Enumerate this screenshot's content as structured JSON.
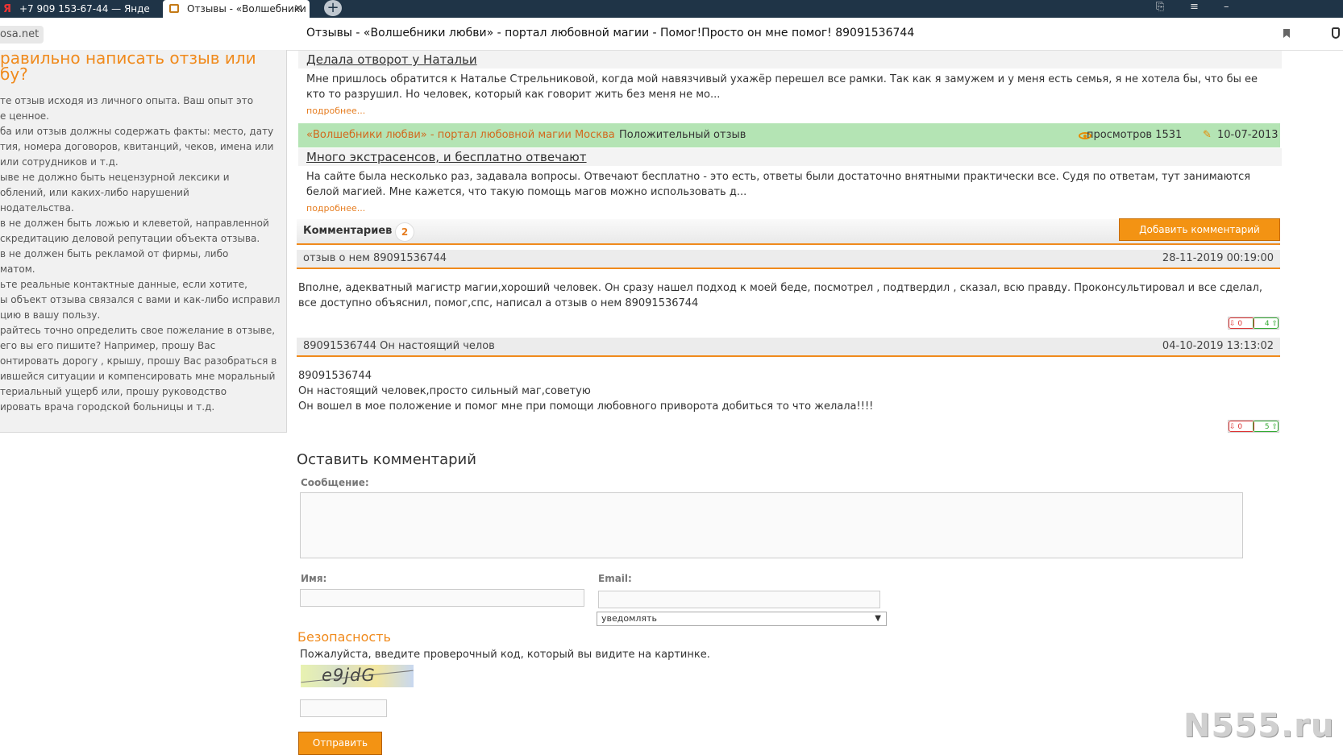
{
  "browser": {
    "tabs": [
      {
        "label": "+7 909 153-67-44 — Янде"
      },
      {
        "label": "Отзывы - «Волшебники"
      }
    ],
    "window_controls": {
      "close_tab": "✕",
      "new_tab": "+",
      "menu": "≡",
      "minimize": "–",
      "bookmarks": "⎘"
    },
    "domain": "osa.net",
    "page_title": "Отзывы - «Волшебники любви» - портал любовной магии - Помог!Просто он мне помог! 89091536744"
  },
  "sidebar": {
    "title_lines": [
      "равильно написать отзыв или",
      "бу?"
    ],
    "lines": [
      "те отзыв исходя из личного опыта. Ваш опыт это",
      "е ценное.",
      "ба или отзыв должны содержать факты: место, дату",
      "тия, номера договоров, квитанций, чеков, имена или",
      "или сотрудников и т.д.",
      "ыве не должно быть нецензурной лексики и",
      "облений, или каких-либо нарушений",
      "нодательства.",
      "в не должен быть ложью и клеветой, направленной",
      "скредитацию деловой репутации объекта отзыва.",
      "в не должен быть рекламой от фирмы, либо",
      "матом.",
      "ьте реальные контактные данные, если хотите,",
      "ы объект отзыва связался с вами и как-либо исправил",
      "цию в вашу пользу.",
      "райтесь точно определить свое пожелание в отзыве,",
      "его вы его пишите? Например, прошу Вас",
      "онтировать дорогу , крышу, прошу Вас разобраться в",
      "ившейся ситуации и компенсировать мне моральный",
      "териальный ущерб или, прошу руководство",
      "ировать врача городской больницы и т.д."
    ]
  },
  "related": [
    {
      "title": "Делала отворот у Натальи",
      "body": "Мне пришлось обратится к Наталье Стрельниковой, когда мой навязчивый ухажёр перешел все рамки. Так как я замужем и у меня есть семья, я не хотела бы, что бы ее кто то разрушил. Но человек, который как говорит жить без меня не мо...",
      "more": "подробнее..."
    },
    {
      "title": "Много экстрасенсов, и бесплатно отвечают",
      "body": "На сайте была несколько раз, задавала вопросы. Отвечают бесплатно - это есть, ответы были достаточно внятными практически все. Судя по ответам, тут занимаются белой магией. Мне кажется, что такую помощь магов можно использовать д...",
      "more": "подробнее..."
    }
  ],
  "meta_bar": {
    "org": "«Волшебники любви» - портал любовной магии Москва",
    "type": "Положительный отзыв",
    "views": "просмотров 1531",
    "date": "10-07-2013"
  },
  "comments_header": {
    "label": "Комментариев",
    "count": "2",
    "add_button": "Добавить комментарий"
  },
  "comments": [
    {
      "title": "отзыв о нем 89091536744",
      "date": "28-11-2019 00:19:00",
      "text_lines": [
        "Вполне, адекватный магистр магии,хороший человек. Он сразу нашел подход к моей беде, посмотрел , подтвердил , сказал, всю правду. Проконсультировал и все сделал, все доступно объяснил, помог,спс, написал а отзыв о нем 89091536744"
      ],
      "votes_down": "0",
      "votes_up": "4"
    },
    {
      "title": "89091536744 Он настоящий челов",
      "date": "04-10-2019 13:13:02",
      "text_lines": [
        "89091536744",
        "Он настоящий человек,просто сильный маг,советую",
        "Он вошел в мое положение и помог мне при помощи любовного приворота добиться то что желала!!!!"
      ],
      "votes_down": "0",
      "votes_up": "5"
    }
  ],
  "form": {
    "title": "Оставить комментарий",
    "message_label": "Сообщение:",
    "name_label": "Имя:",
    "email_label": "Email:",
    "notify_option": "уведомлять",
    "security_title": "Безопасность",
    "security_text": "Пожалуйста, введите проверочный код, который вы видите на картинке.",
    "captcha_text": "e9jdG",
    "submit": "Отправить"
  },
  "watermark": "N555.ru",
  "colors": {
    "accent": "#f08a1c",
    "green_bar": "#b4e4b4",
    "tabbar": "#1f3447"
  }
}
